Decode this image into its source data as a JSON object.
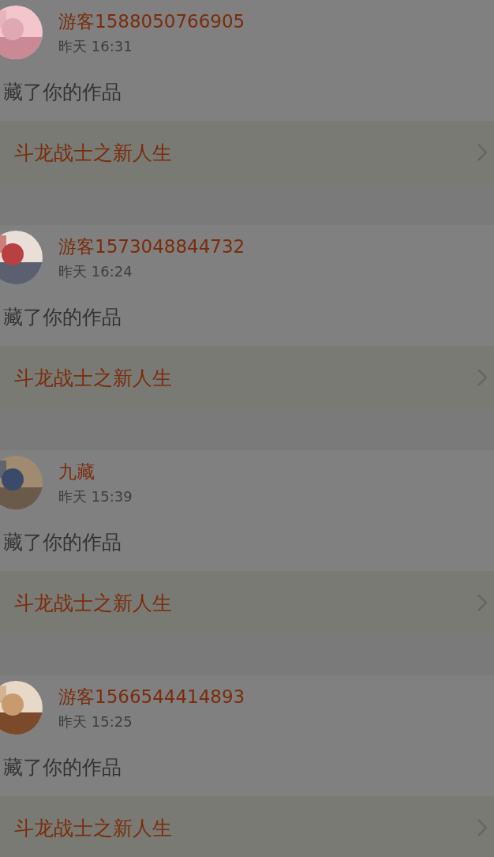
{
  "notifications": [
    {
      "name": "游客1588050766905",
      "time": "昨天 16:31",
      "action": "藏了你的作品",
      "work": "斗龙战士之新人生"
    },
    {
      "name": "游客1573048844732",
      "time": "昨天 16:24",
      "action": "藏了你的作品",
      "work": "斗龙战士之新人生"
    },
    {
      "name": "九藏",
      "time": "昨天 15:39",
      "action": "藏了你的作品",
      "work": "斗龙战士之新人生"
    },
    {
      "name": "游客1566544414893",
      "time": "昨天 15:25",
      "action": "藏了你的作品",
      "work": "斗龙战士之新人生"
    }
  ]
}
